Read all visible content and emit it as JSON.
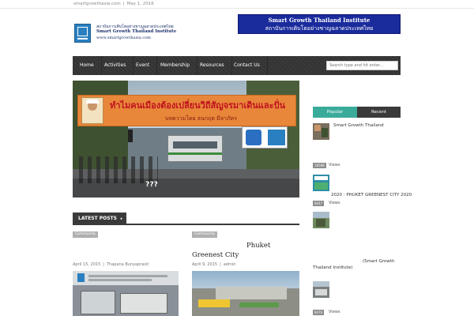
{
  "topbar": {
    "domain": "smartgrowthasia.com",
    "date": "May 1, 2016"
  },
  "logo": {
    "line1": "สถาบันการเติบโตอย่างชาญฉลาดประเทศไทย",
    "line2": "Smart Growth Thailand Institute",
    "line3": "www.smartgrowthasia.com"
  },
  "banner": {
    "line1": "Smart Growth Thailand Institute",
    "line2": "สถาบันการเติบโตอย่างชาญฉลาดประเทศไทย"
  },
  "nav": {
    "items": [
      "Home",
      "Activities",
      "Event",
      "Membership",
      "Resources",
      "Contact Us"
    ],
    "search_placeholder": "Search type and hit enter..."
  },
  "hero": {
    "headline": "ทำไมคนเมืองต้องเปลี่ยนวิถีสัญจรมาเดินและปั่น",
    "byline": "บทความโดย ธนกฤต มีลาภัคร",
    "caption": "???"
  },
  "latest": {
    "label": "LATEST POSTS"
  },
  "posts": [
    {
      "category": "Community",
      "title": "",
      "date": "April 15, 2015",
      "author": "Thapana Bunyaprasit"
    },
    {
      "category": "Community",
      "title_line1": "Phuket",
      "title_line2": "Greenest City",
      "date": "April 9, 2015",
      "author": "admin"
    }
  ],
  "sidebar": {
    "tabs": {
      "popular": "Popular",
      "recent": "Recent"
    },
    "items": [
      {
        "title": "Smart Growth Thailand",
        "views": "18598",
        "views_label": "Views"
      },
      {
        "title": "2020 : PHUKET GREENEST CITY 2020",
        "views": "8447",
        "views_label": "Views"
      },
      {
        "title_a": "(Smart Growth",
        "title_b": "Thailand Institute)",
        "views": "8476",
        "views_label": "Views"
      }
    ]
  },
  "colors": {
    "nav_bg": "#3a3a3a",
    "accent": "#3aab9a",
    "banner": "#1a2b9c"
  }
}
